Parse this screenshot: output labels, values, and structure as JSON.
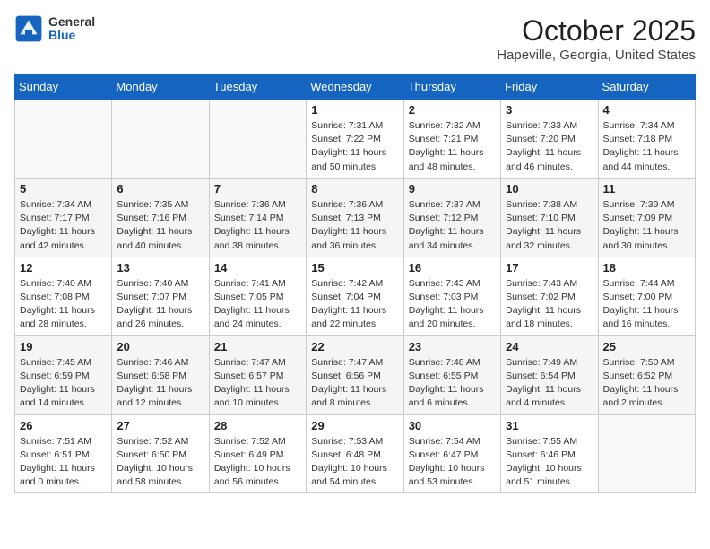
{
  "header": {
    "logo_general": "General",
    "logo_blue": "Blue",
    "month_title": "October 2025",
    "location": "Hapeville, Georgia, United States"
  },
  "days_of_week": [
    "Sunday",
    "Monday",
    "Tuesday",
    "Wednesday",
    "Thursday",
    "Friday",
    "Saturday"
  ],
  "weeks": [
    [
      {
        "day": "",
        "info": ""
      },
      {
        "day": "",
        "info": ""
      },
      {
        "day": "",
        "info": ""
      },
      {
        "day": "1",
        "info": "Sunrise: 7:31 AM\nSunset: 7:22 PM\nDaylight: 11 hours and 50 minutes."
      },
      {
        "day": "2",
        "info": "Sunrise: 7:32 AM\nSunset: 7:21 PM\nDaylight: 11 hours and 48 minutes."
      },
      {
        "day": "3",
        "info": "Sunrise: 7:33 AM\nSunset: 7:20 PM\nDaylight: 11 hours and 46 minutes."
      },
      {
        "day": "4",
        "info": "Sunrise: 7:34 AM\nSunset: 7:18 PM\nDaylight: 11 hours and 44 minutes."
      }
    ],
    [
      {
        "day": "5",
        "info": "Sunrise: 7:34 AM\nSunset: 7:17 PM\nDaylight: 11 hours and 42 minutes."
      },
      {
        "day": "6",
        "info": "Sunrise: 7:35 AM\nSunset: 7:16 PM\nDaylight: 11 hours and 40 minutes."
      },
      {
        "day": "7",
        "info": "Sunrise: 7:36 AM\nSunset: 7:14 PM\nDaylight: 11 hours and 38 minutes."
      },
      {
        "day": "8",
        "info": "Sunrise: 7:36 AM\nSunset: 7:13 PM\nDaylight: 11 hours and 36 minutes."
      },
      {
        "day": "9",
        "info": "Sunrise: 7:37 AM\nSunset: 7:12 PM\nDaylight: 11 hours and 34 minutes."
      },
      {
        "day": "10",
        "info": "Sunrise: 7:38 AM\nSunset: 7:10 PM\nDaylight: 11 hours and 32 minutes."
      },
      {
        "day": "11",
        "info": "Sunrise: 7:39 AM\nSunset: 7:09 PM\nDaylight: 11 hours and 30 minutes."
      }
    ],
    [
      {
        "day": "12",
        "info": "Sunrise: 7:40 AM\nSunset: 7:08 PM\nDaylight: 11 hours and 28 minutes."
      },
      {
        "day": "13",
        "info": "Sunrise: 7:40 AM\nSunset: 7:07 PM\nDaylight: 11 hours and 26 minutes."
      },
      {
        "day": "14",
        "info": "Sunrise: 7:41 AM\nSunset: 7:05 PM\nDaylight: 11 hours and 24 minutes."
      },
      {
        "day": "15",
        "info": "Sunrise: 7:42 AM\nSunset: 7:04 PM\nDaylight: 11 hours and 22 minutes."
      },
      {
        "day": "16",
        "info": "Sunrise: 7:43 AM\nSunset: 7:03 PM\nDaylight: 11 hours and 20 minutes."
      },
      {
        "day": "17",
        "info": "Sunrise: 7:43 AM\nSunset: 7:02 PM\nDaylight: 11 hours and 18 minutes."
      },
      {
        "day": "18",
        "info": "Sunrise: 7:44 AM\nSunset: 7:00 PM\nDaylight: 11 hours and 16 minutes."
      }
    ],
    [
      {
        "day": "19",
        "info": "Sunrise: 7:45 AM\nSunset: 6:59 PM\nDaylight: 11 hours and 14 minutes."
      },
      {
        "day": "20",
        "info": "Sunrise: 7:46 AM\nSunset: 6:58 PM\nDaylight: 11 hours and 12 minutes."
      },
      {
        "day": "21",
        "info": "Sunrise: 7:47 AM\nSunset: 6:57 PM\nDaylight: 11 hours and 10 minutes."
      },
      {
        "day": "22",
        "info": "Sunrise: 7:47 AM\nSunset: 6:56 PM\nDaylight: 11 hours and 8 minutes."
      },
      {
        "day": "23",
        "info": "Sunrise: 7:48 AM\nSunset: 6:55 PM\nDaylight: 11 hours and 6 minutes."
      },
      {
        "day": "24",
        "info": "Sunrise: 7:49 AM\nSunset: 6:54 PM\nDaylight: 11 hours and 4 minutes."
      },
      {
        "day": "25",
        "info": "Sunrise: 7:50 AM\nSunset: 6:52 PM\nDaylight: 11 hours and 2 minutes."
      }
    ],
    [
      {
        "day": "26",
        "info": "Sunrise: 7:51 AM\nSunset: 6:51 PM\nDaylight: 11 hours and 0 minutes."
      },
      {
        "day": "27",
        "info": "Sunrise: 7:52 AM\nSunset: 6:50 PM\nDaylight: 10 hours and 58 minutes."
      },
      {
        "day": "28",
        "info": "Sunrise: 7:52 AM\nSunset: 6:49 PM\nDaylight: 10 hours and 56 minutes."
      },
      {
        "day": "29",
        "info": "Sunrise: 7:53 AM\nSunset: 6:48 PM\nDaylight: 10 hours and 54 minutes."
      },
      {
        "day": "30",
        "info": "Sunrise: 7:54 AM\nSunset: 6:47 PM\nDaylight: 10 hours and 53 minutes."
      },
      {
        "day": "31",
        "info": "Sunrise: 7:55 AM\nSunset: 6:46 PM\nDaylight: 10 hours and 51 minutes."
      },
      {
        "day": "",
        "info": ""
      }
    ]
  ]
}
